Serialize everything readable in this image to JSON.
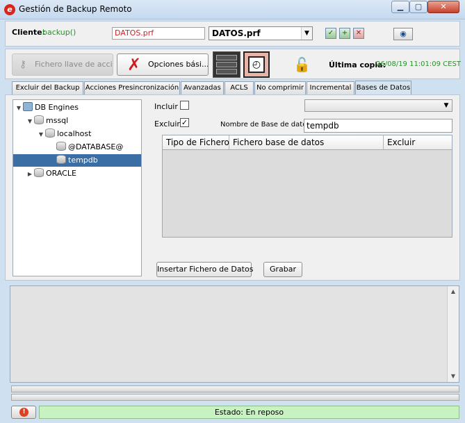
{
  "window": {
    "title": "Gestión de Backup Remoto",
    "min_glyph": "▁",
    "max_glyph": "▢",
    "close_glyph": "✕"
  },
  "client": {
    "label": "Cliente:",
    "value": "backup()",
    "profile_field": "DATOS.prf",
    "profile_select": "DATOS.prf"
  },
  "toolbar": {
    "keyfile_label": "Fichero llave de acci...",
    "options_label": "Opciones bási...",
    "last_copy_label": "Última copia:",
    "last_copy_value": "26/08/19 11:01:09 CEST"
  },
  "tabs": [
    "Excluir del Backup",
    "Acciones Presincronización",
    "Avanzadas",
    "ACLS",
    "No comprimir",
    "Incremental",
    "Bases de Datos"
  ],
  "active_tab_index": 6,
  "tree": {
    "root": "DB Engines",
    "mssql": "mssql",
    "localhost": "localhost",
    "db1": "@DATABASE@",
    "db2": "tempdb",
    "oracle": "ORACLE"
  },
  "form": {
    "incluir_label": "Incluir",
    "incluir_checked": false,
    "excluir_label": "Excluir",
    "excluir_checked": true,
    "dbname_label": "Nombre de Base de datos",
    "dbname_value": "tempdb",
    "check_glyph": "✓"
  },
  "table": {
    "columns": [
      "Tipo de Fichero",
      "Fichero base de datos",
      "Excluir"
    ]
  },
  "buttons": {
    "insert_label": "Insertar Fichero de Datos",
    "save_label": "Grabar"
  },
  "status": {
    "text": "Estado: En reposo"
  },
  "colors": {
    "accent_green": "#2f8d2f",
    "profile_red": "#d02020",
    "selection_blue": "#3a6ea5",
    "status_green": "#c9f2c3"
  }
}
